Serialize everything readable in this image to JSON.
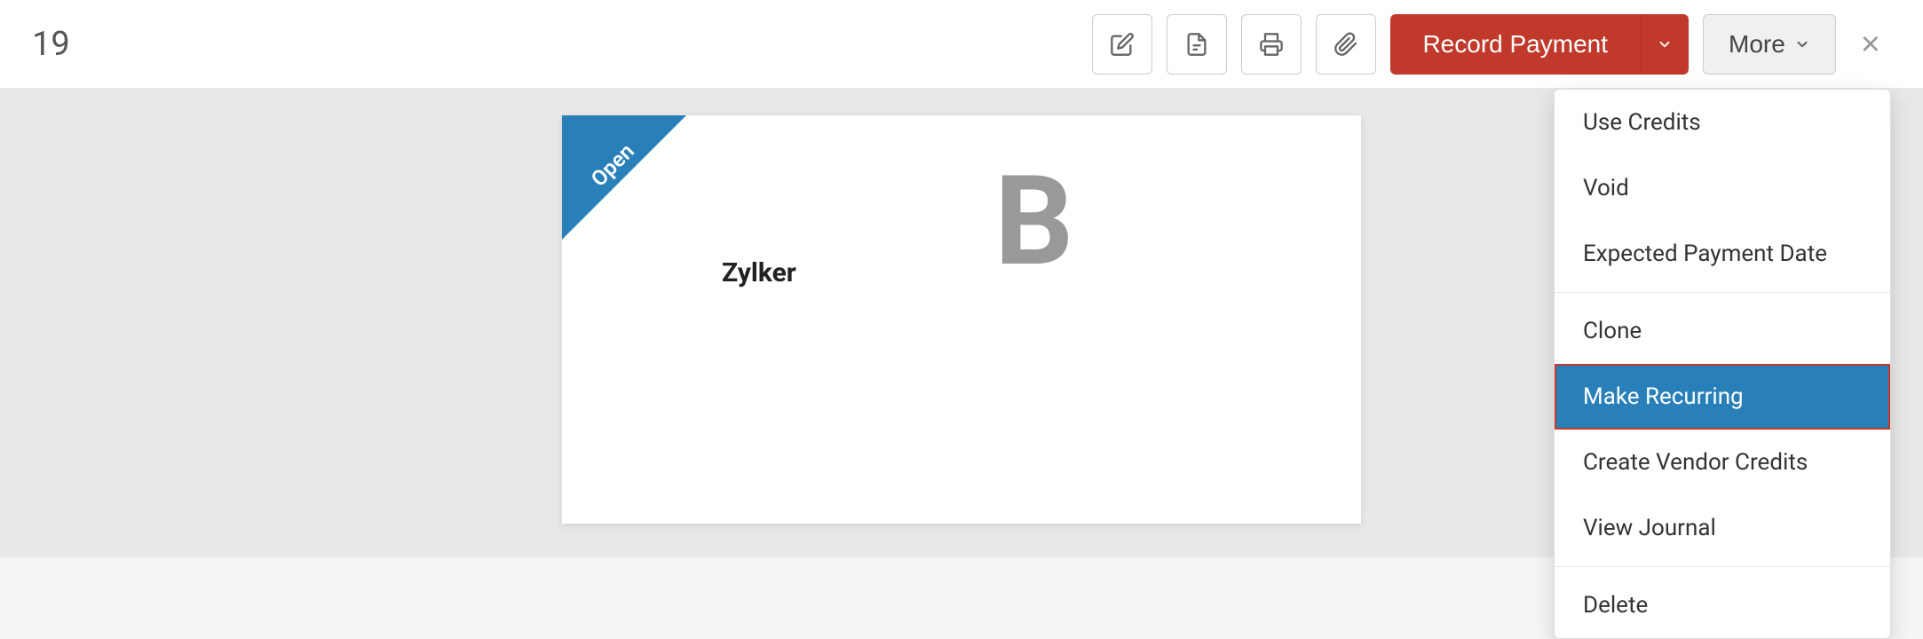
{
  "header": {
    "page_number": "19",
    "icons": {
      "edit": "✎",
      "pdf": "📄",
      "print": "🖨",
      "attach": "📎"
    },
    "record_payment_label": "Record Payment",
    "more_label": "More",
    "close_label": "×"
  },
  "document": {
    "ribbon_text": "Open",
    "company_name": "Zylker"
  },
  "dropdown": {
    "items": [
      {
        "id": "use-credits",
        "label": "Use Credits",
        "active": false,
        "divider_after": false
      },
      {
        "id": "void",
        "label": "Void",
        "active": false,
        "divider_after": false
      },
      {
        "id": "expected-payment-date",
        "label": "Expected Payment Date",
        "active": false,
        "divider_after": true
      },
      {
        "id": "clone",
        "label": "Clone",
        "active": false,
        "divider_after": false
      },
      {
        "id": "make-recurring",
        "label": "Make Recurring",
        "active": true,
        "divider_after": false
      },
      {
        "id": "create-vendor-credits",
        "label": "Create Vendor Credits",
        "active": false,
        "divider_after": false
      },
      {
        "id": "view-journal",
        "label": "View Journal",
        "active": false,
        "divider_after": true
      },
      {
        "id": "delete",
        "label": "Delete",
        "active": false,
        "divider_after": false
      }
    ]
  },
  "colors": {
    "record_payment_bg": "#c0392b",
    "active_item_bg": "#2980b9",
    "ribbon_bg": "#2980b9"
  }
}
